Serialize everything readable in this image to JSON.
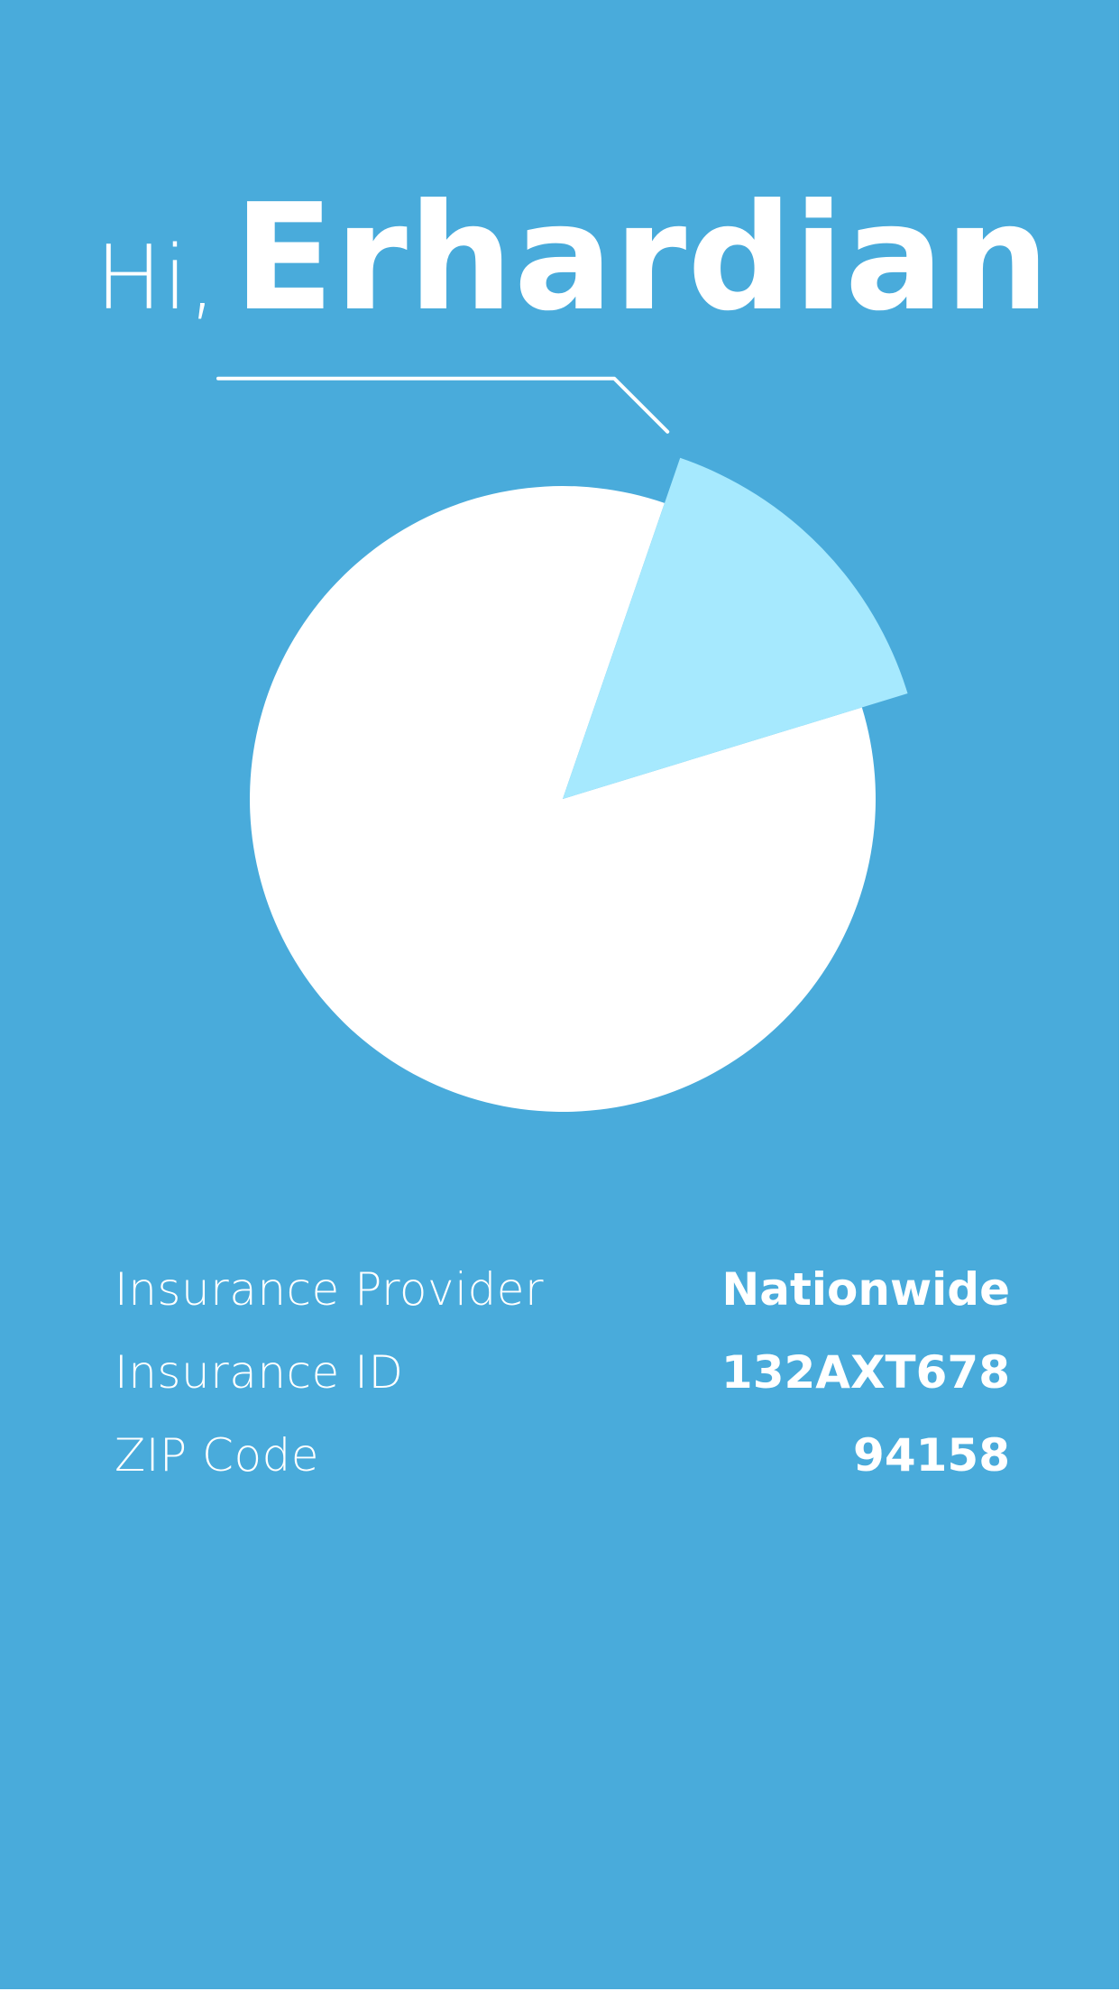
{
  "greeting": {
    "prefix": "Hi,",
    "name": "Erhardian"
  },
  "chart_data": {
    "type": "pie",
    "slices": [
      {
        "label": "",
        "fraction": 0.15,
        "color": "#a6e9fe",
        "exploded": true
      },
      {
        "label": "",
        "fraction": 0.85,
        "color": "#ffffff",
        "exploded": false
      }
    ],
    "start_angle_deg": 19,
    "callout_slice": 0
  },
  "colors": {
    "background": "#49abdb",
    "text": "#ffffff",
    "accent_slice": "#a6e9fe",
    "main_slice": "#ffffff"
  },
  "details": [
    {
      "label": "Insurance Provider",
      "value": "Nationwide"
    },
    {
      "label": "Insurance ID",
      "value": "132AXT678"
    },
    {
      "label": "ZIP Code",
      "value": "94158"
    }
  ]
}
